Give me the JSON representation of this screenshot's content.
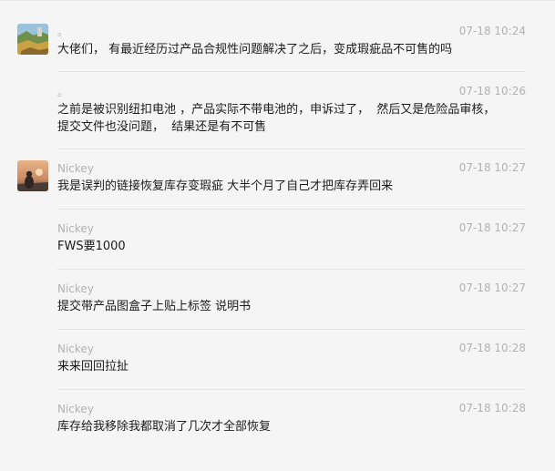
{
  "messages": [
    {
      "sender": "。",
      "time": "07-18 10:24",
      "text": "大佬们， 有最近经历过产品合规性问题解决了之后，变成瑕疵品不可售的吗",
      "avatar": "landscape"
    },
    {
      "sender": "。",
      "time": "07-18 10:26",
      "text": "之前是被识别纽扣电池 ，产品实际不带电池的，申诉过了，  然后又是危险品审核，\n提交文件也没问题，  结果还是有不可售",
      "avatar": null
    },
    {
      "sender": "Nickey",
      "time": "07-18 10:27",
      "text": "我是误判的链接恢复库存变瑕疵 大半个月了自己才把库存弄回来",
      "avatar": "sunset"
    },
    {
      "sender": "Nickey",
      "time": "07-18 10:27",
      "text": "FWS要1000",
      "avatar": null
    },
    {
      "sender": "Nickey",
      "time": "07-18 10:27",
      "text": "提交带产品图盒子上贴上标签 说明书",
      "avatar": null
    },
    {
      "sender": "Nickey",
      "time": "07-18 10:28",
      "text": "来来回回拉扯",
      "avatar": null
    },
    {
      "sender": "Nickey",
      "time": "07-18 10:28",
      "text": "库存给我移除我都取消了几次才全部恢复",
      "avatar": null
    }
  ]
}
